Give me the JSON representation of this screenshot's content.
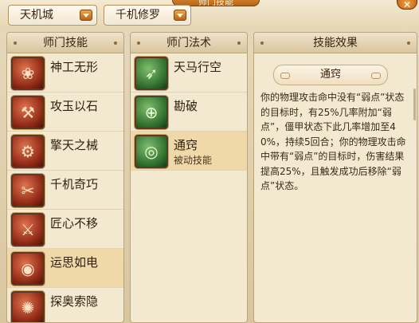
{
  "window": {
    "title": "师门技能",
    "close_symbol": "✕"
  },
  "selectors": {
    "faction": "天机城",
    "school": "千机修罗"
  },
  "skills_panel": {
    "header": "师门技能",
    "items": [
      {
        "name": "神工无形",
        "icon": "dragon-emblem-icon"
      },
      {
        "name": "攻玉以石",
        "icon": "stone-rune-icon"
      },
      {
        "name": "擎天之械",
        "icon": "mech-pillar-icon"
      },
      {
        "name": "千机奇巧",
        "icon": "crossed-tools-icon"
      },
      {
        "name": "匠心不移",
        "icon": "hammer-icon"
      },
      {
        "name": "运思如电",
        "icon": "swirl-eye-icon",
        "selected": true
      },
      {
        "name": "探奥索隐",
        "icon": "spiral-icon"
      }
    ]
  },
  "arts_panel": {
    "header": "师门法术",
    "items": [
      {
        "name": "天马行空",
        "icon": "winged-horse-icon"
      },
      {
        "name": "勘破",
        "icon": "target-crosshair-icon"
      },
      {
        "name": "通窍",
        "sub": "被动技能",
        "icon": "green-eye-icon",
        "selected": true
      }
    ]
  },
  "effect_panel": {
    "header": "技能效果",
    "title": "通窍",
    "description": "你的物理攻击命中没有“弱点”状态的目标时，有25%几率附加“弱点”，僵甲状态下此几率增加至40%，持续5回合；你的物理攻击命中带有“弱点”的目标时，伤害结果提高25%，且触发成功后移除“弱点”状态。"
  },
  "colors": {
    "skill_icon_red": "#8a2613",
    "art_icon_green": "#2d6b2a",
    "selected_row": "#f0d9a8"
  }
}
